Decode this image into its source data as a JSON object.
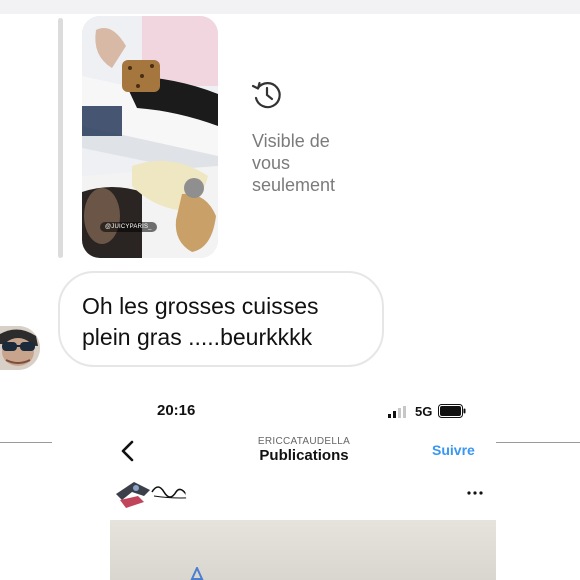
{
  "story_reply": {
    "handle": "@JUICYPARIS_",
    "visibility_note": "Visible de vous seulement",
    "history_icon": "history-icon"
  },
  "message": {
    "text": "Oh les grosses cuisses plein gras .....beurkkkk"
  },
  "screenshot": {
    "status_time": "20:16",
    "network": "5G",
    "header_username": "ERICCATAUDELLA",
    "header_title": "Publications",
    "follow_label": "Suivre",
    "icons": [
      "back-icon",
      "more-icon",
      "battery-icon",
      "signal-icon"
    ],
    "accent_color": "#3897f0"
  }
}
